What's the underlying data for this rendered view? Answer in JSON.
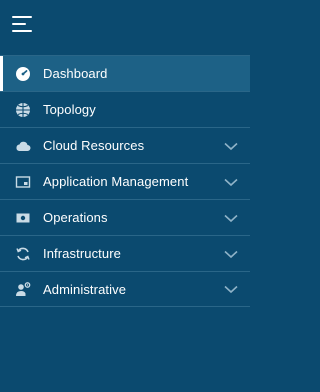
{
  "nav": {
    "items": [
      {
        "label": "Dashboard",
        "icon": "dashboard-gauge-icon",
        "active": true
      },
      {
        "label": "Topology",
        "icon": "topology-globe-icon"
      },
      {
        "label": "Cloud Resources",
        "icon": "cloud-icon",
        "expandable": true
      },
      {
        "label": "Application Management",
        "icon": "application-window-icon",
        "expandable": true
      },
      {
        "label": "Operations",
        "icon": "operations-icon",
        "expandable": true
      },
      {
        "label": "Infrastructure",
        "icon": "refresh-cycle-icon",
        "expandable": true
      },
      {
        "label": "Administrative",
        "icon": "admin-user-gear-icon",
        "expandable": true
      }
    ]
  },
  "colors": {
    "background": "#0b4a6f",
    "active_background": "#1d6186",
    "divider": "#2a6688",
    "text": "#ffffff",
    "chevron": "#8fb3c8"
  }
}
